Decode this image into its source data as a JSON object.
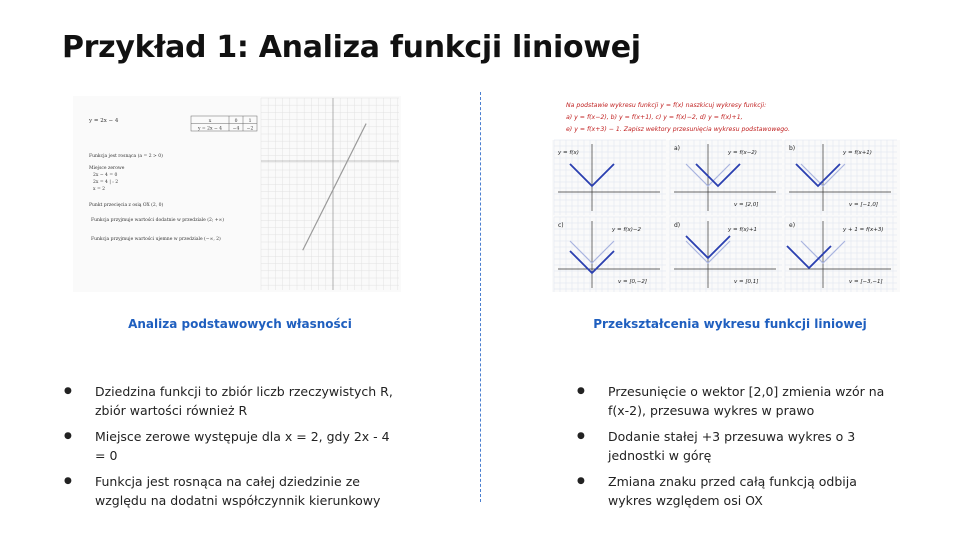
{
  "title": "Przykład 1: Analiza funkcji liniowej",
  "left": {
    "caption": "Analiza podstawowych własności",
    "figure": {
      "equation": "y = 2x − 4",
      "table_header": [
        "x",
        "0",
        "1"
      ],
      "table_row": [
        "y = 2x − 4",
        "−4",
        "−2"
      ],
      "notes": [
        "Funkcja jest rosnąca (a = 2 > 0)",
        "Miejsce zerowe",
        "2x − 4 = 0",
        "2x = 4   | : 2",
        "x = 2",
        "Punkt przecięcia z osią OX (2, 0)",
        "Funkcja przyjmuje wartości dodatnie w przedziale (2; +∞)",
        "Funkcja przyjmuje wartości ujemne w przedziale (−∞, 2)"
      ]
    },
    "bullets": [
      "Dziedzina funkcji to zbiór liczb rzeczywistych R, zbiór wartości również R",
      "Miejsce zerowe występuje dla x = 2, gdy 2x - 4 = 0",
      "Funkcja jest rosnąca na całej dziedzinie ze względu na dodatni współczynnik kierunkowy"
    ]
  },
  "right": {
    "caption": "Przekształcenia wykresu funkcji liniowej",
    "figure": {
      "header_lines": [
        "Na podstawie wykresu funkcji y = f(x) naszkicuj wykresy funkcji:",
        "a) y = f(x−2),  b) y = f(x+1),  c) y = f(x)−2,  d) y = f(x)+1,",
        "e) y = f(x+3) − 1. Zapisz wektory przesunięcia wykresu podstawowego."
      ],
      "panels": [
        {
          "tag": "",
          "label": "y = f(x)",
          "vector": ""
        },
        {
          "tag": "a)",
          "label": "y = f(x−2)",
          "vector": "v = [2,0]"
        },
        {
          "tag": "b)",
          "label": "y = f(x+1)",
          "vector": "v = [−1,0]"
        },
        {
          "tag": "c)",
          "label": "y = f(x)−2",
          "vector": "v = [0,−2]"
        },
        {
          "tag": "d)",
          "label": "y = f(x)+1",
          "vector": "v = [0,1]"
        },
        {
          "tag": "e)",
          "label": "y + 1 = f(x+3)",
          "vector": "v = [−3,−1]"
        }
      ],
      "vee_color": "#2a3fb0",
      "ghost_color": "#a9b4e0"
    },
    "bullets": [
      "Przesunięcie o wektor [2,0] zmienia wzór na f(x-2), przesuwa wykres w prawo",
      "Dodanie stałej +3 przesuwa wykres o 3 jednostki w górę",
      "Zmiana znaku przed całą funkcją odbija wykres względem osi OX"
    ]
  },
  "colors": {
    "accent": "#1f5fbf",
    "divider": "#4a7fd0"
  }
}
